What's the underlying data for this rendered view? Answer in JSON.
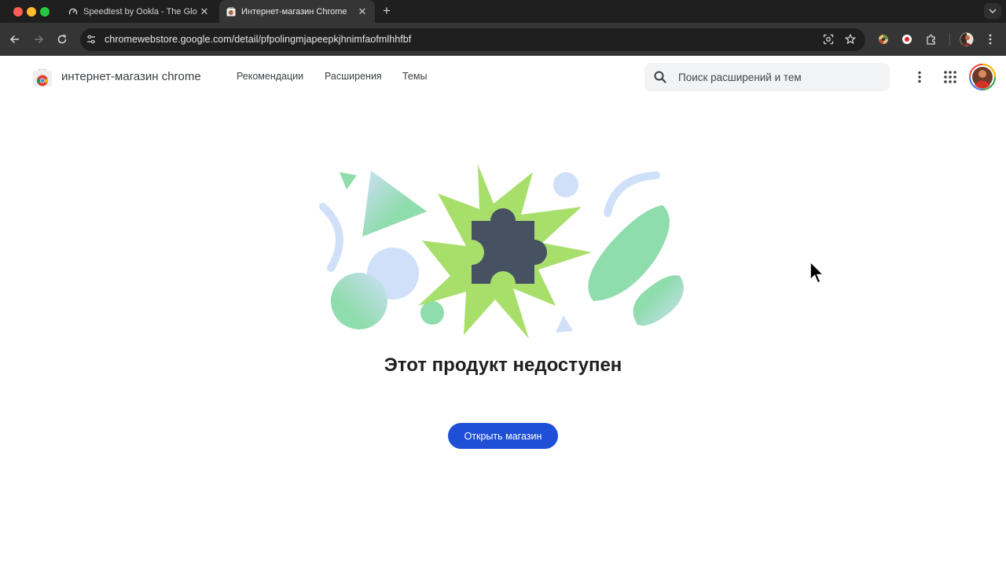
{
  "browser": {
    "tabs": [
      {
        "title": "Speedtest by Ookla - The Glo",
        "active": false,
        "icon": "speedtest-gauge-icon"
      },
      {
        "title": "Интернет-магазин Chrome",
        "active": true,
        "icon": "chrome-web-store-icon"
      }
    ],
    "address": {
      "host": "chromewebstore.google.com",
      "path": "/detail/pfpolingmjapeepkjhnimfaofmlhhfbf"
    }
  },
  "store": {
    "name": "интернет-магазин chrome",
    "nav": [
      "Рекомендации",
      "Расширения",
      "Темы"
    ],
    "search_placeholder": "Поиск расширений и тем"
  },
  "main": {
    "message": "Этот продукт недоступен",
    "button_label": "Открыть магазин"
  },
  "colors": {
    "accent_button": "#1f4fd6",
    "puzzle": "#465262",
    "burst": "#a8df6b",
    "mint": "#8fdcac",
    "light_blue": "#cfe0f8"
  }
}
